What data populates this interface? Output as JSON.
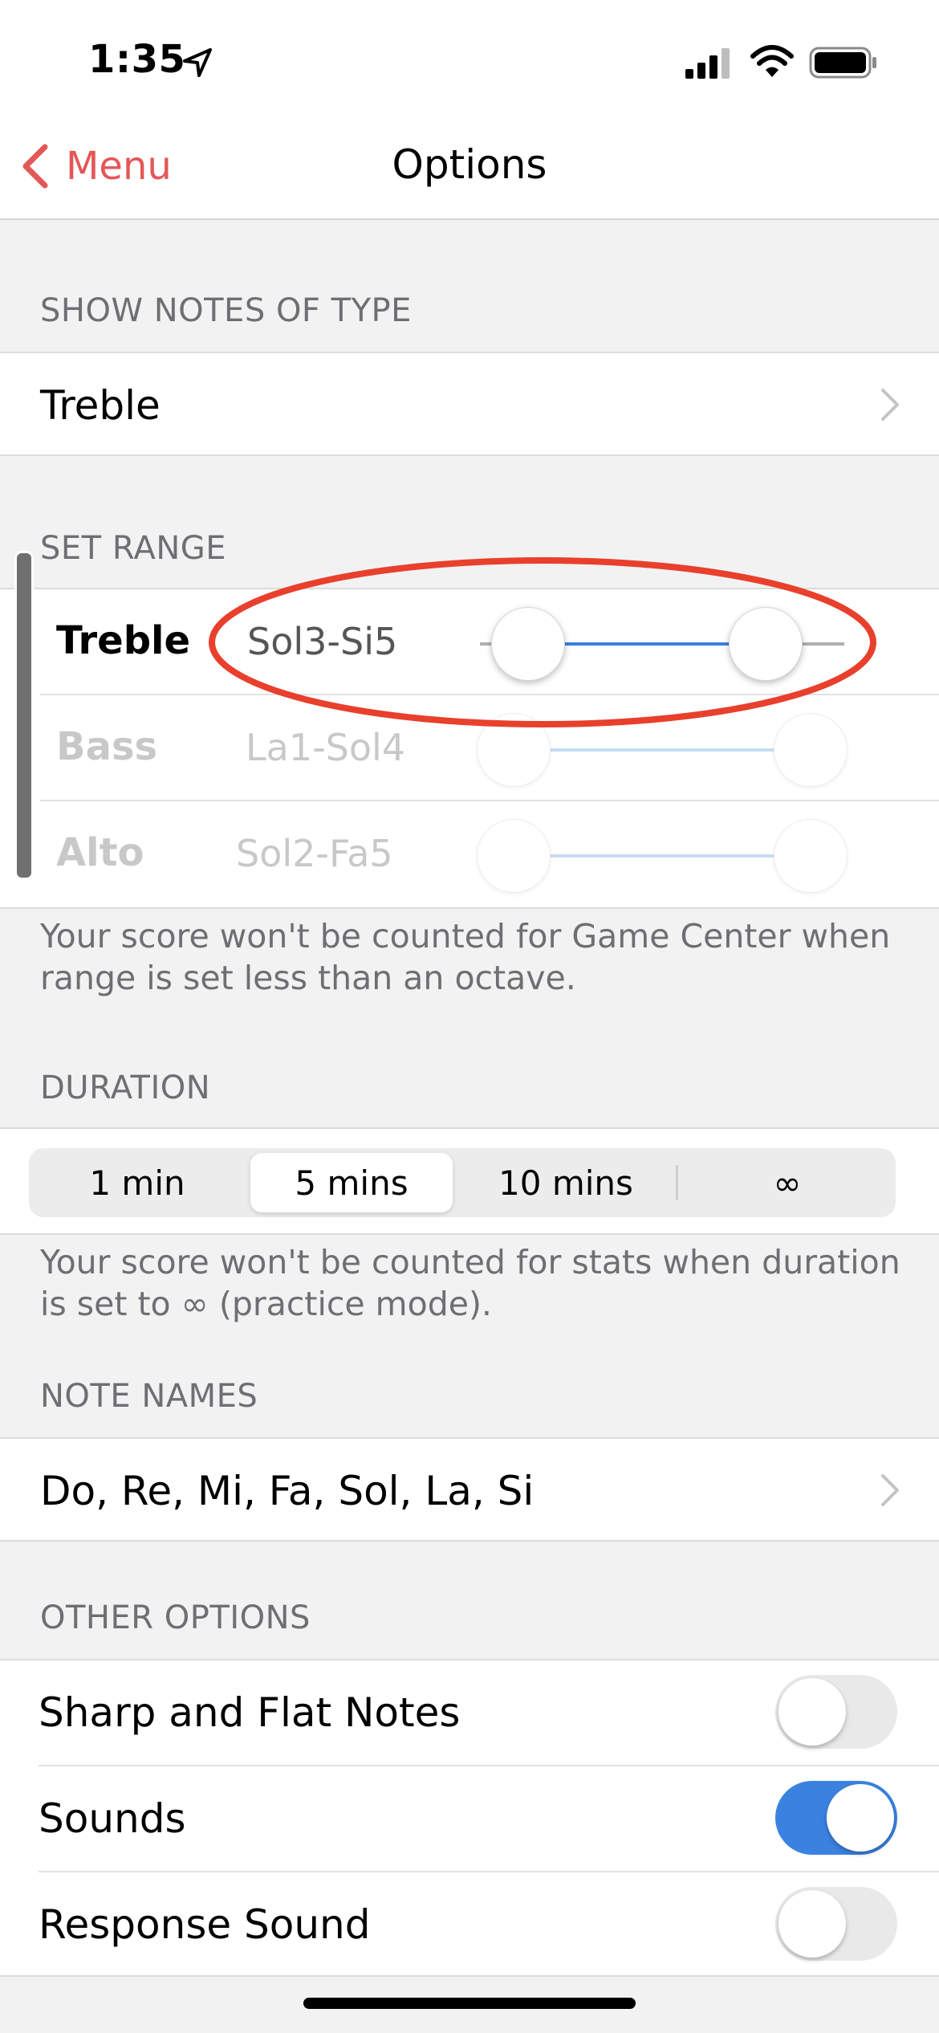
{
  "status_bar": {
    "time": "1:35"
  },
  "nav": {
    "back_label": "Menu",
    "title": "Options"
  },
  "show_notes": {
    "header": "SHOW NOTES OF TYPE",
    "value": "Treble"
  },
  "set_range": {
    "header": "SET RANGE",
    "rows": [
      {
        "label": "Treble",
        "range": "Sol3-Si5",
        "enabled": true
      },
      {
        "label": "Bass",
        "range": "La1-Sol4",
        "enabled": false
      },
      {
        "label": "Alto",
        "range": "Sol2-Fa5",
        "enabled": false
      }
    ],
    "footer": "Your score won't be counted for Game Center when range is set less than an octave."
  },
  "duration": {
    "header": "DURATION",
    "options": [
      "1 min",
      "5 mins",
      "10 mins",
      "∞"
    ],
    "selected": "5 mins",
    "footer": "Your score won't be counted for stats when duration is set to ∞ (practice mode)."
  },
  "note_names": {
    "header": "NOTE NAMES",
    "value": "Do, Re, Mi, Fa, Sol, La, Si"
  },
  "other_options": {
    "header": "OTHER OPTIONS",
    "items": [
      {
        "label": "Sharp and Flat Notes",
        "on": false
      },
      {
        "label": "Sounds",
        "on": true
      },
      {
        "label": "Response Sound",
        "on": false
      }
    ]
  },
  "colors": {
    "accent_red": "#e45757",
    "toggle_on": "#3b82e0",
    "slider_active": "#3d7fdc",
    "annotation_red": "#e8402c"
  }
}
